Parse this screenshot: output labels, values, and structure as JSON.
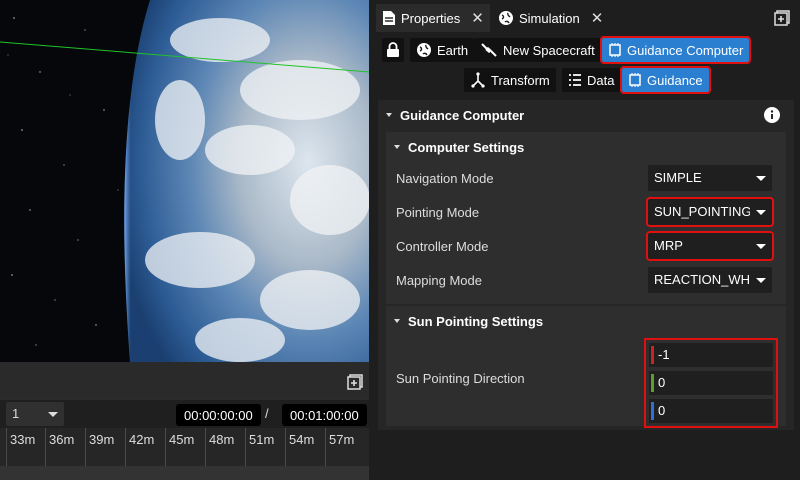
{
  "tabs": [
    {
      "label": "Properties",
      "icon": "document-icon"
    },
    {
      "label": "Simulation",
      "icon": "globe-icon"
    }
  ],
  "breadcrumbs": {
    "row1": [
      {
        "label": "",
        "icon": "lock-icon"
      },
      {
        "label": "Earth",
        "icon": "globe-icon"
      },
      {
        "label": "New Spacecraft",
        "icon": "satellite-icon"
      },
      {
        "label": "Guidance Computer",
        "icon": "chip-icon",
        "selected": true
      }
    ],
    "row2": [
      {
        "label": "Transform",
        "icon": "transform-icon"
      },
      {
        "label": "Data",
        "icon": "list-icon"
      },
      {
        "label": "Guidance",
        "icon": "chip-icon",
        "selected": true
      }
    ]
  },
  "component": {
    "title": "Guidance Computer",
    "computer_settings": {
      "title": "Computer Settings",
      "rows": [
        {
          "label": "Navigation Mode",
          "value": "SIMPLE",
          "highlighted": false
        },
        {
          "label": "Pointing Mode",
          "value": "SUN_POINTING",
          "highlighted": true
        },
        {
          "label": "Controller Mode",
          "value": "MRP",
          "highlighted": true
        },
        {
          "label": "Mapping Mode",
          "value": "REACTION_WHEELS",
          "highlighted": false
        }
      ]
    },
    "sun_pointing": {
      "title": "Sun Pointing Settings",
      "label": "Sun Pointing Direction",
      "x": "-1",
      "y": "0",
      "z": "0"
    }
  },
  "timeline": {
    "speed": "1",
    "current_time": "00:00:00:00",
    "separator": "/",
    "end_time": "00:01:00:00",
    "ticks": [
      "33m",
      "36m",
      "39m",
      "42m",
      "45m",
      "48m",
      "51m",
      "54m",
      "57m"
    ]
  },
  "colors": {
    "selected": "#2b7fd0",
    "highlight": "#e01010",
    "axis_x": "#d02020",
    "axis_y": "#5aa02a",
    "axis_z": "#2f6fd8"
  }
}
